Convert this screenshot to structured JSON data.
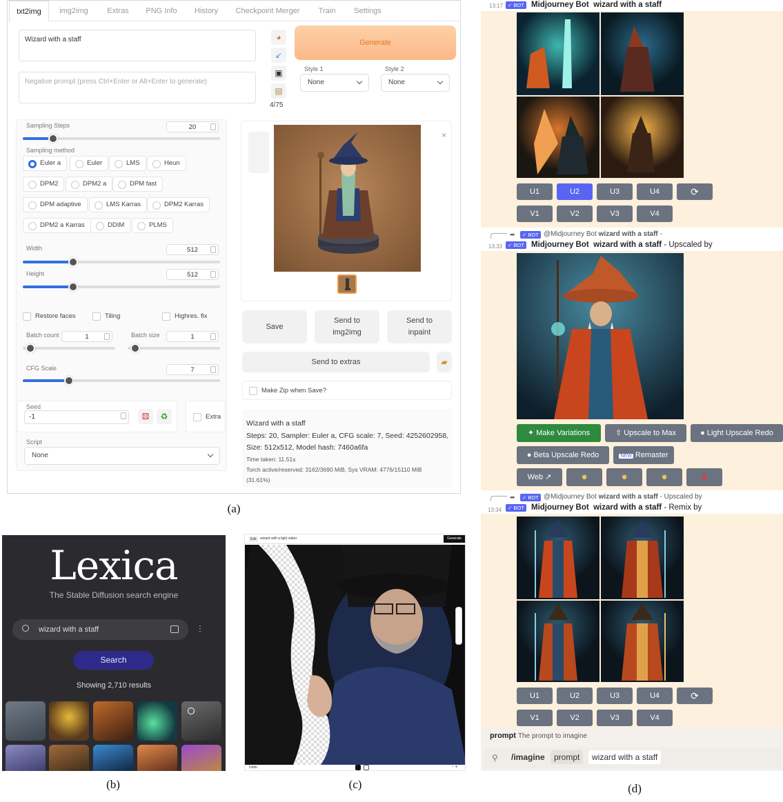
{
  "captions": {
    "a": "(a)",
    "b": "(b)",
    "c": "(c)",
    "d": "(d)"
  },
  "sdui": {
    "tabs": [
      "txt2img",
      "img2img",
      "Extras",
      "PNG Info",
      "History",
      "Checkpoint Merger",
      "Train",
      "Settings"
    ],
    "prompt": "Wizard with a staff",
    "negative_placeholder": "Negative prompt (press Ctrl+Enter or Alt+Enter to generate)",
    "token_count": "4/75",
    "generate_label": "Generate",
    "style1": {
      "label": "Style 1",
      "value": "None"
    },
    "style2": {
      "label": "Style 2",
      "value": "None"
    },
    "sampling_steps": {
      "label": "Sampling Steps",
      "value": "20",
      "fraction": 0.14
    },
    "sampling_method": {
      "label": "Sampling method",
      "options": [
        "Euler a",
        "Euler",
        "LMS",
        "Heun",
        "DPM2",
        "DPM2 a",
        "DPM fast",
        "DPM adaptive",
        "LMS Karras",
        "DPM2 Karras",
        "DPM2 a Karras",
        "DDIM",
        "PLMS"
      ],
      "selected": "Euler a"
    },
    "width": {
      "label": "Width",
      "value": "512",
      "fraction": 0.24
    },
    "height": {
      "label": "Height",
      "value": "512",
      "fraction": 0.24
    },
    "restore_faces": "Restore faces",
    "tiling": "Tiling",
    "highres_fix": "Highres. fix",
    "batch_count": {
      "label": "Batch count",
      "value": "1",
      "fraction": 0.0
    },
    "batch_size": {
      "label": "Batch size",
      "value": "1",
      "fraction": 0.0
    },
    "cfg_scale": {
      "label": "CFG Scale",
      "value": "7",
      "fraction": 0.22
    },
    "seed": {
      "label": "Seed",
      "value": "-1"
    },
    "extra": "Extra",
    "script": {
      "label": "Script",
      "value": "None"
    },
    "save_label": "Save",
    "send_img2img": "Send to img2img",
    "send_inpaint": "Send to inpaint",
    "send_extras": "Send to extras",
    "make_zip": "Make Zip when Save?",
    "info": {
      "prompt": "Wizard with a staff",
      "line1": "Steps: 20, Sampler: Euler a, CFG scale: 7, Seed: 4252602958,",
      "line2": "Size: 512x512, Model hash: 7460a6fa",
      "time": "Time taken: 11.51s",
      "vram": "Torch active/reserved: 3162/3690 MiB, Sys VRAM: 4776/15110 MiB",
      "vram2": "(31.61%)"
    }
  },
  "lexica": {
    "logo": "Lexica",
    "tagline": "The Stable Diffusion search engine",
    "query": "wizard with a staff",
    "search_label": "Search",
    "results": "Showing 2,710 results"
  },
  "editor": {
    "prompt": "wizard with a light saber",
    "generate": "Generate",
    "badge": "Edit",
    "undo": "Undo"
  },
  "discord": {
    "bot_badge": "✓ BOT",
    "msg1": {
      "time": "13:17",
      "author": "Midjourney Bot",
      "prompt": "wizard with a staff"
    },
    "grid_buttons_u": [
      "U1",
      "U2",
      "U3",
      "U4"
    ],
    "grid_buttons_v": [
      "V1",
      "V2",
      "V3",
      "V4"
    ],
    "reply2": {
      "author": "@Midjourney Bot",
      "prompt": "wizard with a staff",
      "suffix": " -"
    },
    "msg2": {
      "time": "13:33",
      "author": "Midjourney Bot",
      "prompt": "wizard with a staff",
      "suffix": " - Upscaled by"
    },
    "actions": {
      "make_variations": "Make Variations",
      "upscale_max": "Upscale to Max",
      "light_redo": "Light Upscale Redo",
      "beta_redo": "Beta Upscale Redo",
      "remaster": "Remaster",
      "new": "NEW",
      "web": "Web"
    },
    "reply3": {
      "author": "@Midjourney Bot",
      "prompt": "wizard with a staff",
      "suffix": " - Upscaled by"
    },
    "msg3": {
      "time": "13:34",
      "author": "Midjourney Bot",
      "prompt": "wizard with a staff",
      "suffix": " - Remix by"
    },
    "prompt_hint": {
      "key": "prompt",
      "desc": "The prompt to imagine"
    },
    "command": {
      "name": "/imagine",
      "param": "prompt",
      "value": "wizard with a staff"
    }
  },
  "colors": {
    "accent_blue": "#2f6fe0",
    "generate_orange": "#e0772c",
    "discord_blurple": "#5865f2",
    "discord_green": "#2d8a3e",
    "lexica_button": "#2e2a8a"
  }
}
